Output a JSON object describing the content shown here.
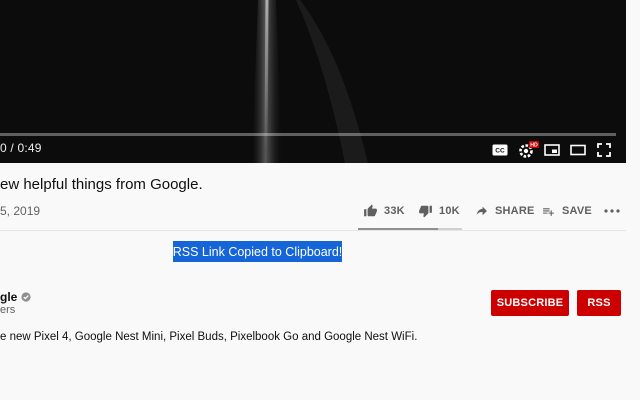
{
  "player": {
    "time_display": "0 / 0:49",
    "controls": [
      "subtitles-icon",
      "settings-hd-icon",
      "miniplayer-icon",
      "theater-mode-icon",
      "fullscreen-icon"
    ],
    "hd_badge": "HD"
  },
  "video": {
    "title": "ew helpful things from Google.",
    "date": "5, 2019"
  },
  "actions": {
    "like_count": "33K",
    "dislike_count": "10K",
    "share_label": "SHARE",
    "save_label": "SAVE",
    "like_ratio": 0.77
  },
  "toast": {
    "message": "RSS Link Copied to Clipboard!"
  },
  "channel": {
    "name": "gle",
    "subscribers": "ers",
    "subscribe_label": "SUBSCRIBE",
    "rss_label": "RSS"
  },
  "description": {
    "text": "e new Pixel 4, Google Nest Mini, Pixel Buds, Pixelbook Go and Google Nest WiFi."
  },
  "colors": {
    "accent_red": "#cc0000",
    "toast_blue": "#1565d8",
    "muted_text": "#606060"
  }
}
